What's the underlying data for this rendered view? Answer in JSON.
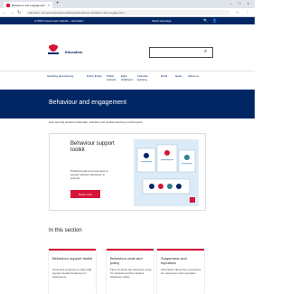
{
  "browser": {
    "tab_title": "Behaviour and engagement",
    "tab_close": "×",
    "new_tab": "+",
    "window_controls": "– □ ×",
    "url": "education.nsw.gov.au/student-wellbeing/attendance-behaviour-and-engagement",
    "back": "←",
    "forward": "→",
    "reload": "↻",
    "toolbar_icons": "☆ ⋮"
  },
  "site": {
    "util_left": "A NSW Government website – Education",
    "util_right": "Select language",
    "util_icons": "🔍 👤",
    "brand": "Education",
    "search_placeholder": "",
    "nav": [
      {
        "label": "Teaching and learning"
      },
      {
        "label": "Policy library"
      },
      {
        "label": "Public schools"
      },
      {
        "label": "Early childhood"
      },
      {
        "label": "Inclusive learning"
      },
      {
        "label": "Rural"
      },
      {
        "label": "News"
      },
      {
        "label": "About us"
      }
    ]
  },
  "hero": {
    "title": "Behaviour and engagement"
  },
  "intro": "How we help students build safe, inclusive and positive learning environments.",
  "feature_card": {
    "title": "Behaviour support toolkit",
    "body": "Practical tools and resources to support positive behaviour in schools.",
    "button": "Read more"
  },
  "section": {
    "title": "In this section",
    "tiles": [
      {
        "title": "Behaviour support toolkit",
        "body": "Tools and resources to help staff support student behaviour in classrooms."
      },
      {
        "title": "Behaviour code and policy",
        "body": "Find out about the behaviour code for students and the student behaviour policy."
      },
      {
        "title": "Suspension and expulsion",
        "body": "Information about the procedures for suspension and expulsion."
      }
    ]
  },
  "colors": {
    "navy": "#002664",
    "red": "#d7153a"
  }
}
